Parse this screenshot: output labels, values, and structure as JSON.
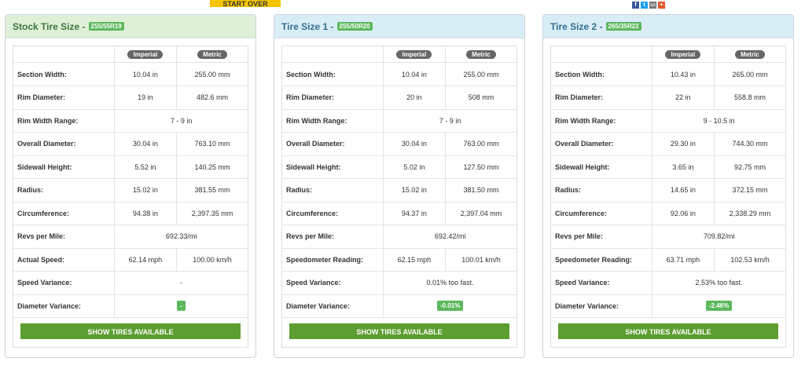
{
  "start_over_label": "START OVER",
  "share_icons": [
    {
      "name": "facebook-icon",
      "glyph": "f",
      "color": "#3b5998"
    },
    {
      "name": "twitter-icon",
      "glyph": "t",
      "color": "#1da1f2"
    },
    {
      "name": "print-icon",
      "glyph": "▭",
      "color": "#777777"
    },
    {
      "name": "more-icon",
      "glyph": "+",
      "color": "#e4572e"
    }
  ],
  "header_cols": {
    "imperial": "Imperial",
    "metric": "Metric"
  },
  "row_labels": {
    "section_width": "Section Width:",
    "rim_diameter": "Rim Diameter:",
    "rim_width_range": "Rim Width Range:",
    "overall_diameter": "Overall Diameter:",
    "sidewall_height": "Sidewall Height:",
    "radius": "Radius:",
    "circumference": "Circumference:",
    "revs_per_mile": "Revs per Mile:",
    "speed_variance": "Speed Variance:",
    "diameter_variance": "Diameter Variance:"
  },
  "show_tires_label": "SHOW TIRES AVAILABLE",
  "panels": [
    {
      "title": "Stock Tire Size",
      "size": "255/55R19",
      "speed_label": "Actual Speed:",
      "section_width": [
        "10.04 in",
        "255.00 mm"
      ],
      "rim_diameter": [
        "19 in",
        "482.6 mm"
      ],
      "rim_width_range": "7 - 9 in",
      "overall_diameter": [
        "30.04 in",
        "763.10 mm"
      ],
      "sidewall_height": [
        "5.52 in",
        "140.25 mm"
      ],
      "radius": [
        "15.02 in",
        "381.55 mm"
      ],
      "circumference": [
        "94.38 in",
        "2,397.35 mm"
      ],
      "revs_per_mile": "692.33/mi",
      "speed": [
        "62.14 mph",
        "100.00 km/h"
      ],
      "speed_variance": "-",
      "diameter_variance": "-"
    },
    {
      "title": "Tire Size 1",
      "size": "255/50R20",
      "speed_label": "Speedometer Reading:",
      "section_width": [
        "10.04 in",
        "255.00 mm"
      ],
      "rim_diameter": [
        "20 in",
        "508 mm"
      ],
      "rim_width_range": "7 - 9 in",
      "overall_diameter": [
        "30.04 in",
        "763.00 mm"
      ],
      "sidewall_height": [
        "5.02 in",
        "127.50 mm"
      ],
      "radius": [
        "15.02 in",
        "381.50 mm"
      ],
      "circumference": [
        "94.37 in",
        "2,397.04 mm"
      ],
      "revs_per_mile": "692.42/mi",
      "speed": [
        "62.15 mph",
        "100.01 km/h"
      ],
      "speed_variance": "0.01% too fast.",
      "diameter_variance": "-0.01%"
    },
    {
      "title": "Tire Size 2",
      "size": "265/35R22",
      "speed_label": "Speedometer Reading:",
      "section_width": [
        "10.43 in",
        "265.00 mm"
      ],
      "rim_diameter": [
        "22 in",
        "558.8 mm"
      ],
      "rim_width_range": "9 - 10.5 in",
      "overall_diameter": [
        "29.30 in",
        "744.30 mm"
      ],
      "sidewall_height": [
        "3.65 in",
        "92.75 mm"
      ],
      "radius": [
        "14.65 in",
        "372.15 mm"
      ],
      "circumference": [
        "92.06 in",
        "2,338.29 mm"
      ],
      "revs_per_mile": "709.82/mi",
      "speed": [
        "63.71 mph",
        "102.53 km/h"
      ],
      "speed_variance": "2.53% too fast.",
      "diameter_variance": "-2.46%"
    }
  ]
}
